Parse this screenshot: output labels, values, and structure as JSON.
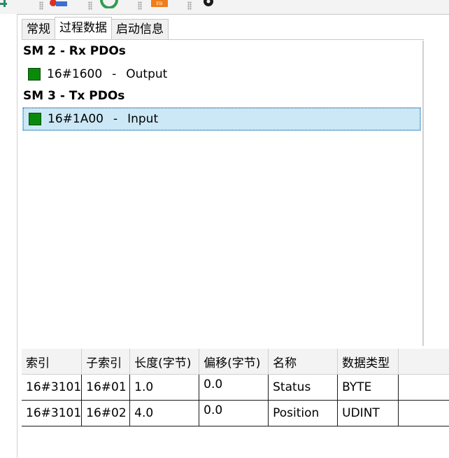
{
  "toolbar": {
    "icons": [
      "network-icon",
      "device-icon",
      "refresh-icon",
      "esi-icon",
      "gear-icon"
    ],
    "esi_label": "ESI"
  },
  "tabs": [
    {
      "label": "常规"
    },
    {
      "label": "过程数据"
    },
    {
      "label": "启动信息"
    }
  ],
  "active_tab": "过程数据",
  "pdo_tree": {
    "rx_header": "SM 2 - Rx PDOs",
    "rx_items": [
      {
        "index": "16#1600",
        "separator": "-",
        "name": "Output",
        "color": "#0a8a0a"
      }
    ],
    "tx_header": "SM 3 - Tx PDOs",
    "tx_items": [
      {
        "index": "16#1A00",
        "separator": "-",
        "name": "Input",
        "color": "#0a8a0a",
        "selected": true
      }
    ]
  },
  "entry_table": {
    "headers": [
      "索引",
      "子索引",
      "长度(字节)",
      "偏移(字节)",
      "名称",
      "数据类型"
    ],
    "rows": [
      [
        "16#3101",
        "16#01",
        "1.0",
        "0.0",
        "Status",
        "BYTE"
      ],
      [
        "16#3101",
        "16#02",
        "4.0",
        "0.0",
        "Position",
        "UDINT"
      ]
    ]
  },
  "colors": {
    "selection_background": "#cce8f6",
    "pdo_color": "#0a8a0a"
  }
}
